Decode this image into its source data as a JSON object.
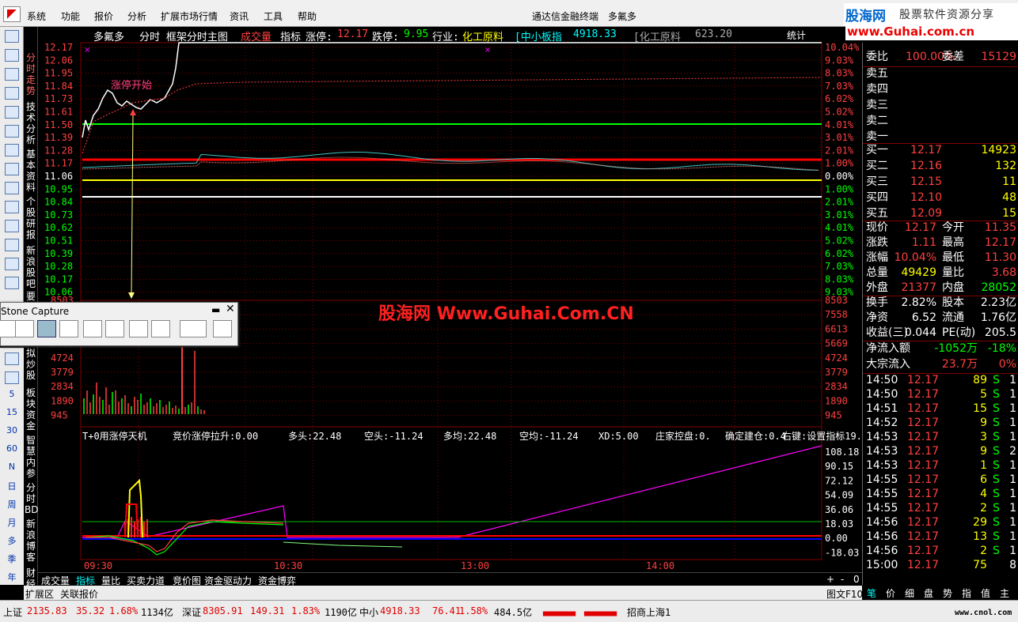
{
  "menu": {
    "items": [
      "系统",
      "功能",
      "报价",
      "分析",
      "扩展市场行情",
      "资讯",
      "工具",
      "帮助"
    ],
    "app_title": "通达信金融终端",
    "stock_name": "多氟多"
  },
  "brand": {
    "logo": "股海网",
    "slogan": "股票软件资源分享",
    "url": "www.Guhai.com.cn"
  },
  "vertical_tabs": [
    "分时走势",
    "技术分析",
    "基本资料",
    "个股研报",
    "新浪股吧",
    "要",
    "拟炒股",
    "板块资金",
    "智慧内参",
    "分时BD",
    "新浪博客",
    "财经"
  ],
  "side_letters": [
    "5",
    "15",
    "30",
    "60",
    "N",
    "日",
    "周",
    "月",
    "多",
    "季",
    "年"
  ],
  "header": {
    "name": "多氟多",
    "view": "分时 框架分时主图",
    "vol_label": "成交量",
    "ind": "指标",
    "up_lbl": "涨停:",
    "up_val": "12.17",
    "down_lbl": "跌停:",
    "down_val": "9.95",
    "industry_lbl": "行业:",
    "industry": "化工原料",
    "idx1": "[中小板指",
    "idx1_val": "4918.33",
    "idx2": "[化工原料",
    "idx2_val": "623.20",
    "stat": "统计"
  },
  "price_axis": [
    "12.17",
    "12.06",
    "11.95",
    "11.84",
    "11.73",
    "11.61",
    "11.50",
    "11.39",
    "11.28",
    "11.17",
    "11.06",
    "10.95",
    "10.84",
    "10.73",
    "10.62",
    "10.51",
    "10.39",
    "10.28",
    "10.17",
    "10.06"
  ],
  "pct_axis": [
    "10.04%",
    "9.03%",
    "8.03%",
    "7.03%",
    "6.02%",
    "5.02%",
    "4.01%",
    "3.01%",
    "2.01%",
    "1.00%",
    "0.00%",
    "1.00%",
    "2.01%",
    "3.01%",
    "4.01%",
    "5.02%",
    "6.02%",
    "7.03%",
    "8.03%",
    "9.03%"
  ],
  "vol_axis": [
    "8503",
    "7558",
    "6613",
    "5669",
    "4724",
    "3779",
    "2834",
    "1890",
    "945"
  ],
  "annotation": "涨停开始",
  "watermark": "股海网 Www.Guhai.Com.CN",
  "indicator": {
    "name": "T+0用涨停天机",
    "items": [
      "竞价涨停拉升:0.00",
      "多头:22.48",
      "空头:-11.24",
      "多均:22.48",
      "空均:-11.24",
      "XD:5.00",
      "庄家控盘:0.",
      "确定建仓:0.4",
      "右键:设置指标19."
    ]
  },
  "ind_axis": [
    "108.18",
    "90.15",
    "72.12",
    "54.09",
    "36.06",
    "18.03",
    "0.00",
    "-18.03"
  ],
  "time_axis": [
    "09:30",
    "10:30",
    "13:00",
    "14:00"
  ],
  "bottom_tabs": [
    "成交量",
    "指标",
    "量比",
    "买卖力道",
    "竞价图",
    "资金驱动力",
    "资金博弈"
  ],
  "ext": {
    "a": "扩展区",
    "b": "关联报价",
    "c": "图文F10"
  },
  "panel": {
    "wb": {
      "l": "委比",
      "v": "100.00%",
      "l2": "委差",
      "v2": "15129"
    },
    "sells": [
      "卖五",
      "卖四",
      "卖三",
      "卖二",
      "卖一"
    ],
    "buys": [
      {
        "l": "买一",
        "p": "12.17",
        "q": "14923"
      },
      {
        "l": "买二",
        "p": "12.16",
        "q": "132"
      },
      {
        "l": "买三",
        "p": "12.15",
        "q": "11"
      },
      {
        "l": "买四",
        "p": "12.10",
        "q": "48"
      },
      {
        "l": "买五",
        "p": "12.09",
        "q": "15"
      }
    ],
    "stats": [
      {
        "l": "现价",
        "v": "12.17",
        "l2": "今开",
        "v2": "11.35",
        "c": "#ff4040",
        "c2": "#ff4040"
      },
      {
        "l": "涨跌",
        "v": "1.11",
        "l2": "最高",
        "v2": "12.17",
        "c": "#ff4040",
        "c2": "#ff4040"
      },
      {
        "l": "涨幅",
        "v": "10.04%",
        "l2": "最低",
        "v2": "11.30",
        "c": "#ff4040",
        "c2": "#ff4040"
      },
      {
        "l": "总量",
        "v": "49429",
        "l2": "量比",
        "v2": "3.68",
        "c": "#ffff00",
        "c2": "#ff4040"
      },
      {
        "l": "外盘",
        "v": "21377",
        "l2": "内盘",
        "v2": "28052",
        "c": "#ff4040",
        "c2": "#00ff00"
      }
    ],
    "fund": [
      {
        "l": "换手",
        "v": "2.82%",
        "l2": "股本",
        "v2": "2.23亿"
      },
      {
        "l": "净资",
        "v": "6.52",
        "l2": "流通",
        "v2": "1.76亿"
      },
      {
        "l": "收益(三)",
        "v": "0.044",
        "l2": "PE(动)",
        "v2": "205.5"
      }
    ],
    "flow": [
      {
        "l": "净流入额",
        "v": "-1052万",
        "v2": "-18%",
        "c": "#00ff00"
      },
      {
        "l": "大宗流入",
        "v": "23.7万",
        "v2": "0%",
        "c": "#ff4040"
      }
    ],
    "ticks": [
      {
        "t": "14:50",
        "p": "12.17",
        "q": "89",
        "s": "S",
        "n": "1"
      },
      {
        "t": "14:50",
        "p": "12.17",
        "q": "5",
        "s": "S",
        "n": "1"
      },
      {
        "t": "14:51",
        "p": "12.17",
        "q": "15",
        "s": "S",
        "n": "1"
      },
      {
        "t": "14:52",
        "p": "12.17",
        "q": "9",
        "s": "S",
        "n": "1"
      },
      {
        "t": "14:53",
        "p": "12.17",
        "q": "3",
        "s": "S",
        "n": "1"
      },
      {
        "t": "14:53",
        "p": "12.17",
        "q": "9",
        "s": "S",
        "n": "2"
      },
      {
        "t": "14:53",
        "p": "12.17",
        "q": "1",
        "s": "S",
        "n": "1"
      },
      {
        "t": "14:55",
        "p": "12.17",
        "q": "6",
        "s": "S",
        "n": "1"
      },
      {
        "t": "14:55",
        "p": "12.17",
        "q": "4",
        "s": "S",
        "n": "1"
      },
      {
        "t": "14:55",
        "p": "12.17",
        "q": "2",
        "s": "S",
        "n": "1"
      },
      {
        "t": "14:56",
        "p": "12.17",
        "q": "29",
        "s": "S",
        "n": "1"
      },
      {
        "t": "14:56",
        "p": "12.17",
        "q": "13",
        "s": "S",
        "n": "1"
      },
      {
        "t": "14:56",
        "p": "12.17",
        "q": "2",
        "s": "S",
        "n": "1"
      },
      {
        "t": "15:00",
        "p": "12.17",
        "q": "75",
        "s": "",
        "n": "8"
      }
    ],
    "rtabs": [
      "笔",
      "价",
      "细",
      "盘",
      "势",
      "指",
      "值",
      "主"
    ]
  },
  "capture": {
    "title": "Stone Capture"
  },
  "status": {
    "sh_l": "上证",
    "sh_v": "2135.83",
    "sh_c": "35.32",
    "sh_p": "1.68%",
    "sh_a": "1134亿",
    "sz_l": "深证",
    "sz_v": "8305.91",
    "sz_c": "149.31",
    "sz_p": "1.83%",
    "sz_a": "1190亿",
    "zx_l": "中小",
    "zx_v": "4918.33",
    "zx_c": "76.41",
    "zx_p": "1.58%",
    "zx_a": "484.5亿",
    "broker": "招商上海1",
    "site": "www.cnol.com"
  }
}
